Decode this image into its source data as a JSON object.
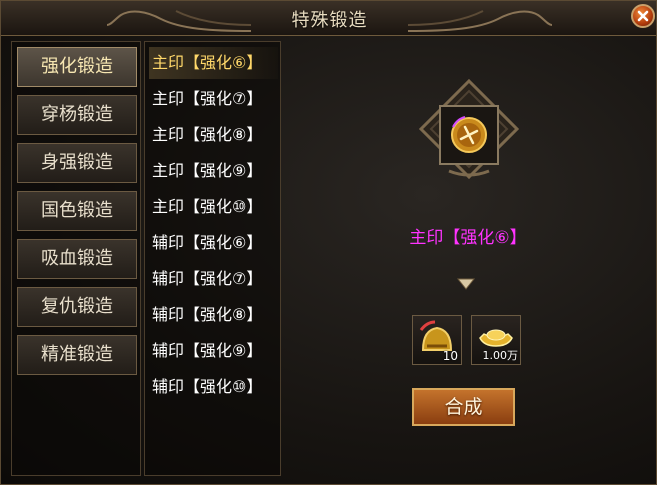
{
  "window": {
    "title": "特殊锻造"
  },
  "tabs": [
    {
      "label": "强化锻造",
      "active": true
    },
    {
      "label": "穿杨锻造",
      "active": false
    },
    {
      "label": "身强锻造",
      "active": false
    },
    {
      "label": "国色锻造",
      "active": false
    },
    {
      "label": "吸血锻造",
      "active": false
    },
    {
      "label": "复仇锻造",
      "active": false
    },
    {
      "label": "精准锻造",
      "active": false
    }
  ],
  "recipes": [
    {
      "label": "主印【强化⑥】",
      "active": true
    },
    {
      "label": "主印【强化⑦】",
      "active": false
    },
    {
      "label": "主印【强化⑧】",
      "active": false
    },
    {
      "label": "主印【强化⑨】",
      "active": false
    },
    {
      "label": "主印【强化⑩】",
      "active": false
    },
    {
      "label": "辅印【强化⑥】",
      "active": false
    },
    {
      "label": "辅印【强化⑦】",
      "active": false
    },
    {
      "label": "辅印【强化⑧】",
      "active": false
    },
    {
      "label": "辅印【强化⑨】",
      "active": false
    },
    {
      "label": "辅印【强化⑩】",
      "active": false
    }
  ],
  "target": {
    "name": "主印【强化⑥】",
    "name_color": "#ff33ff",
    "icon": "seal-icon"
  },
  "materials": [
    {
      "icon": "helmet-icon",
      "qty": "10"
    },
    {
      "icon": "gold-ingot-icon",
      "qty": "1.00万"
    }
  ],
  "compose_button": {
    "label": "合成"
  },
  "colors": {
    "active_text": "#ffd86a",
    "button": "#c4732c",
    "frame_border": "#6b5a42"
  }
}
